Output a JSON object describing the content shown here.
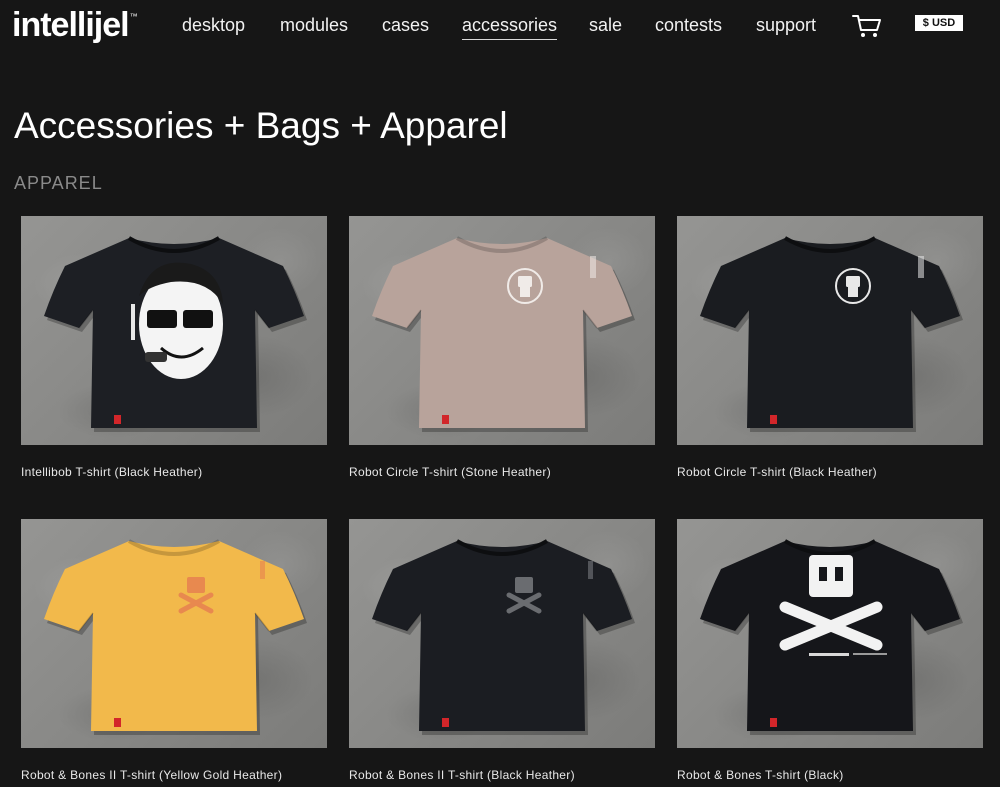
{
  "brand": {
    "logo_text": "intellijel",
    "trademark": "™"
  },
  "nav": {
    "items": [
      {
        "label": "desktop",
        "active": false
      },
      {
        "label": "modules",
        "active": false
      },
      {
        "label": "cases",
        "active": false
      },
      {
        "label": "accessories",
        "active": true
      },
      {
        "label": "sale",
        "active": false
      },
      {
        "label": "contests",
        "active": false
      },
      {
        "label": "support",
        "active": false
      }
    ],
    "cart_icon": "cart-icon",
    "currency": "$ USD"
  },
  "page": {
    "title": "Accessories + Bags + Apparel",
    "section": "APPAREL"
  },
  "products": [
    {
      "name": "Intellibob T-shirt (Black Heather)",
      "shirt_color": "#1d1f24",
      "graphic": "intellibob-face"
    },
    {
      "name": "Robot Circle T-shirt (Stone Heather)",
      "shirt_color": "#b8a39b",
      "graphic": "robot-circle"
    },
    {
      "name": "Robot Circle T-shirt (Black Heather)",
      "shirt_color": "#1a1c20",
      "graphic": "robot-circle"
    },
    {
      "name": "Robot & Bones II T-shirt (Yellow Gold Heather)",
      "shirt_color": "#f2b94b",
      "graphic": "robot-bones-small"
    },
    {
      "name": "Robot & Bones II T-shirt (Black Heather)",
      "shirt_color": "#1b1d22",
      "graphic": "robot-bones-small"
    },
    {
      "name": "Robot & Bones T-shirt (Black)",
      "shirt_color": "#15161a",
      "graphic": "robot-bones-large"
    }
  ]
}
